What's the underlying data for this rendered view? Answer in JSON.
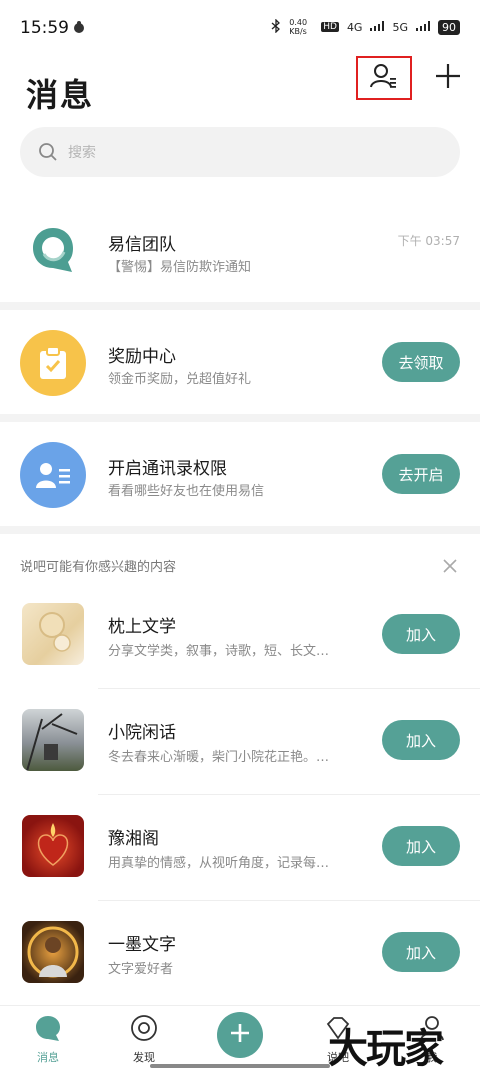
{
  "status_bar": {
    "time": "15:59",
    "net_speed": "0.40 KB/s",
    "hd": "HD",
    "signal_4g": "4G",
    "signal_5g": "5G",
    "battery": "90"
  },
  "header": {
    "title": "消息",
    "contacts_icon": "contacts-icon",
    "plus_icon": "plus-icon"
  },
  "search": {
    "placeholder": "搜索"
  },
  "conversations": [
    {
      "name": "易信团队",
      "preview": "【警惕】易信防欺诈通知",
      "time": "下午 03:57"
    }
  ],
  "promos": [
    {
      "title": "奖励中心",
      "subtitle": "领金币奖励，兑超值好礼",
      "button": "去领取",
      "color": "#f7c34a"
    },
    {
      "title": "开启通讯录权限",
      "subtitle": "看看哪些好友也在使用易信",
      "button": "去开启",
      "color": "#6aa3e8"
    }
  ],
  "recommend": {
    "heading": "说吧可能有你感兴趣的内容",
    "join_label": "加入",
    "groups": [
      {
        "name": "枕上文学",
        "desc": "分享文学类，叙事，诗歌，短、长文…"
      },
      {
        "name": "小院闲话",
        "desc": "冬去春来心渐暖，柴门小院花正艳。…"
      },
      {
        "name": "豫湘阁",
        "desc": "用真挚的情感，从视听角度，记录每…"
      },
      {
        "name": "一墨文字",
        "desc": "文字爱好者"
      }
    ]
  },
  "tabbar": {
    "tabs": [
      {
        "label": "消息"
      },
      {
        "label": "发现"
      },
      {
        "label": "说吧"
      },
      {
        "label": "我"
      }
    ],
    "accent": "#55a196"
  },
  "watermark": "大玩家"
}
